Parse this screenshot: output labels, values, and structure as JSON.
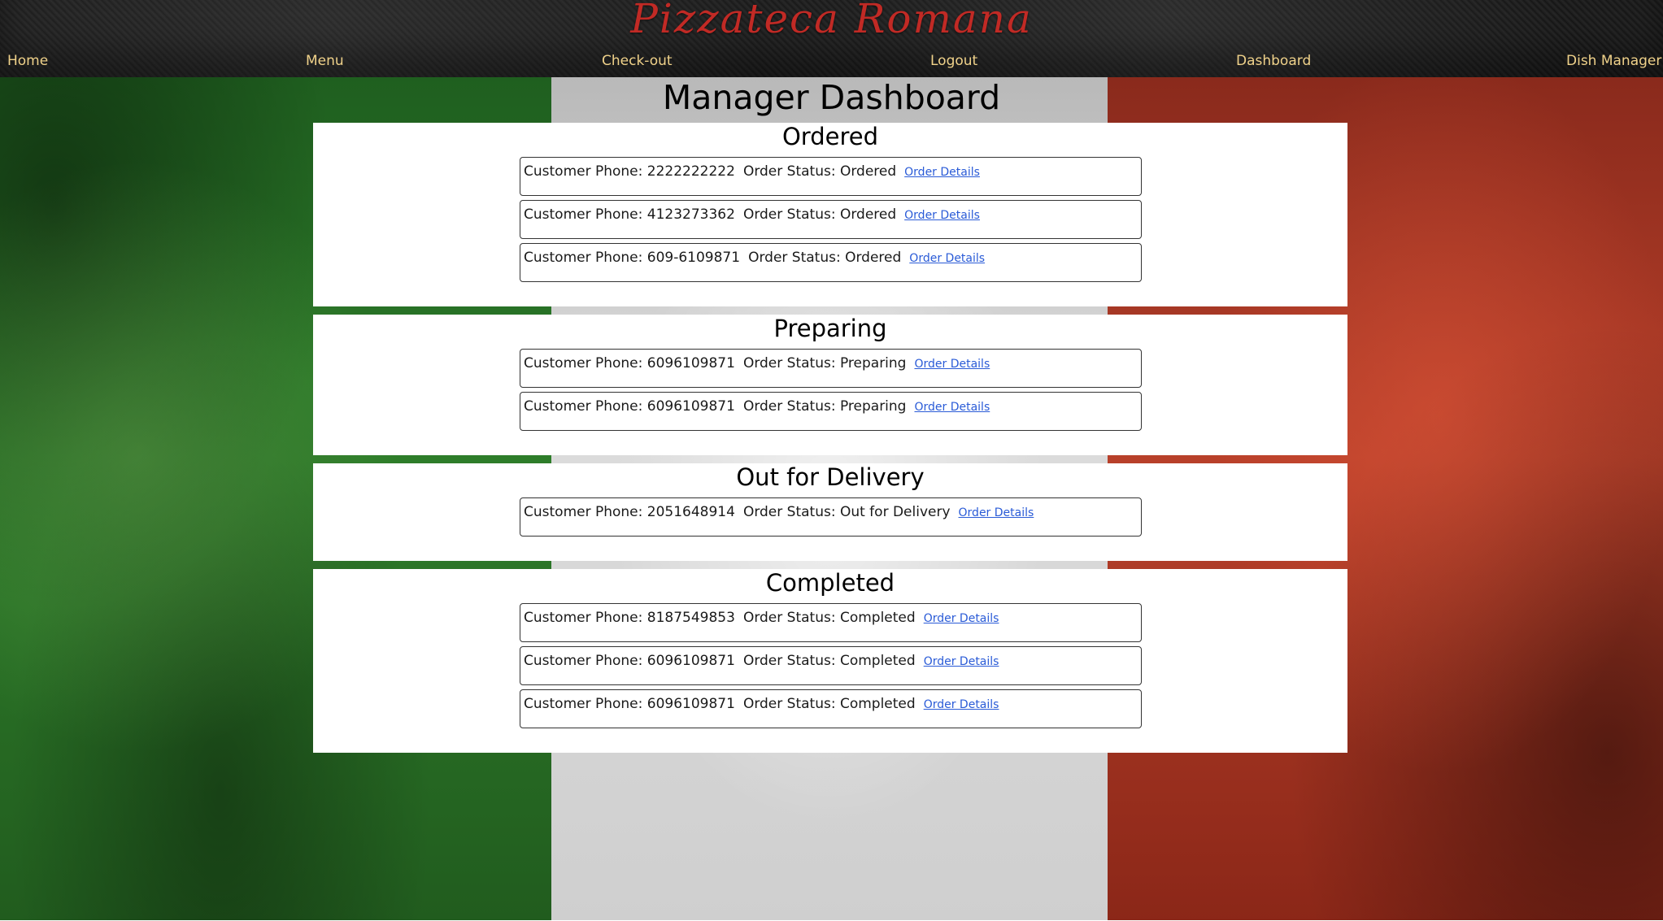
{
  "header": {
    "brand": "Pizzateca Romana",
    "nav": [
      {
        "label": "Home"
      },
      {
        "label": "Menu"
      },
      {
        "label": "Check-out"
      },
      {
        "label": "Logout"
      },
      {
        "label": "Dashboard"
      },
      {
        "label": "Dish Manager"
      }
    ]
  },
  "main": {
    "title": "Manager Dashboard",
    "sections": [
      {
        "title": "Ordered",
        "orders": [
          {
            "phone_label": "Customer Phone: 2222222222",
            "status_label": "Order Status: Ordered",
            "link": "Order Details"
          },
          {
            "phone_label": "Customer Phone: 4123273362",
            "status_label": "Order Status: Ordered",
            "link": "Order Details"
          },
          {
            "phone_label": "Customer Phone: 609-6109871",
            "status_label": "Order Status: Ordered",
            "link": "Order Details"
          }
        ]
      },
      {
        "title": "Preparing",
        "orders": [
          {
            "phone_label": "Customer Phone: 6096109871",
            "status_label": "Order Status: Preparing",
            "link": "Order Details"
          },
          {
            "phone_label": "Customer Phone: 6096109871",
            "status_label": "Order Status: Preparing",
            "link": "Order Details"
          }
        ]
      },
      {
        "title": "Out for Delivery",
        "orders": [
          {
            "phone_label": "Customer Phone: 2051648914",
            "status_label": "Order Status: Out for Delivery",
            "link": "Order Details"
          }
        ]
      },
      {
        "title": "Completed",
        "orders": [
          {
            "phone_label": "Customer Phone: 8187549853",
            "status_label": "Order Status: Completed",
            "link": "Order Details"
          },
          {
            "phone_label": "Customer Phone: 6096109871",
            "status_label": "Order Status: Completed",
            "link": "Order Details"
          },
          {
            "phone_label": "Customer Phone: 6096109871",
            "status_label": "Order Status: Completed",
            "link": "Order Details"
          }
        ]
      }
    ]
  },
  "colors": {
    "brand": "#c12a25",
    "nav_text": "#f0d28a",
    "link": "#2a5bd7",
    "flag_green": "#2e7d2a",
    "flag_white": "#dcdcdc",
    "flag_red": "#b8402a"
  }
}
